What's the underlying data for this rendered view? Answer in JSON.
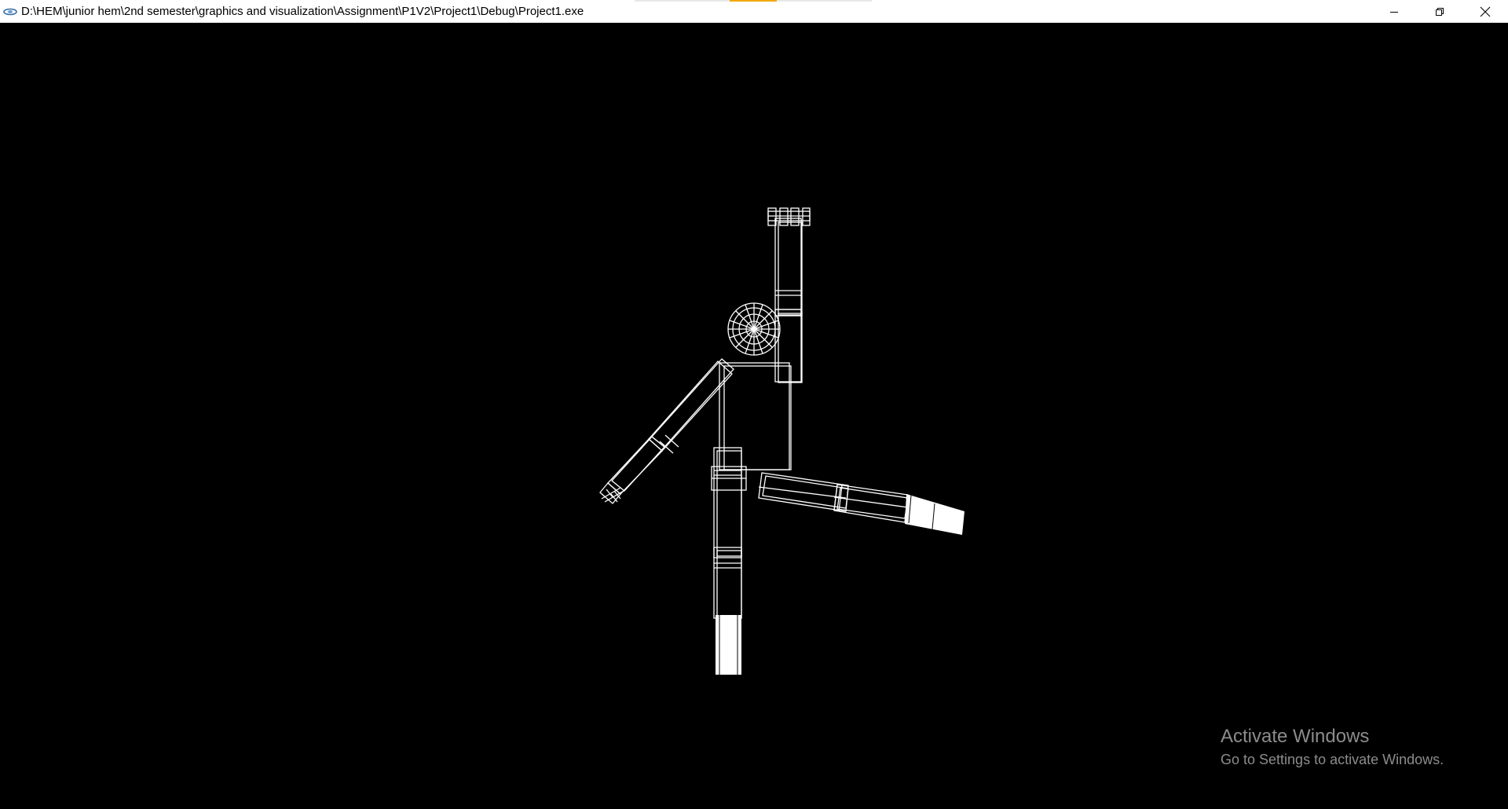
{
  "window": {
    "title": "D:\\HEM\\junior hem\\2nd semester\\graphics and visualization\\Assignment\\P1V2\\Project1\\Debug\\Project1.exe",
    "icon": "app-window-icon",
    "controls": {
      "minimize_icon": "minimize-icon",
      "restore_icon": "restore-icon",
      "close_icon": "close-icon"
    }
  },
  "viewport": {
    "description_colors": {
      "background": "#000000",
      "wireframe": "#ffffff"
    }
  },
  "watermark": {
    "title": "Activate Windows",
    "subtitle": "Go to Settings to activate Windows."
  }
}
